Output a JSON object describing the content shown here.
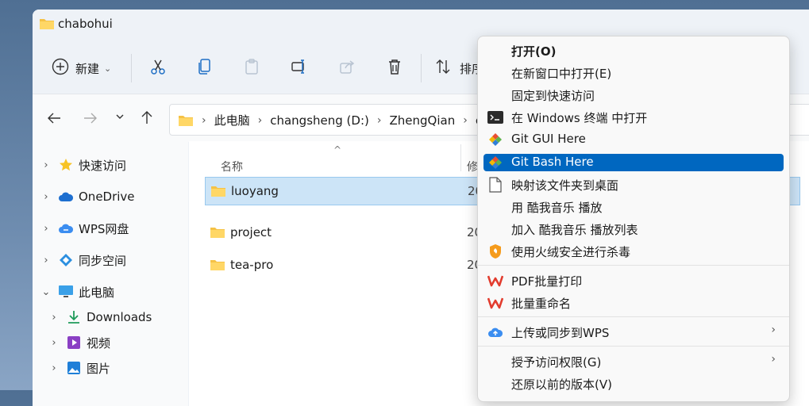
{
  "window": {
    "title": "chabohui"
  },
  "toolbar": {
    "new_label": "新建",
    "sort_label": "排序"
  },
  "breadcrumb": [
    "此电脑",
    "changsheng (D:)",
    "ZhengQian",
    "c"
  ],
  "sidebar": {
    "items": [
      {
        "label": "快速访问",
        "icon": "star-icon"
      },
      {
        "label": "OneDrive",
        "icon": "cloud-icon"
      },
      {
        "label": "WPS网盘",
        "icon": "wps-cloud-icon"
      },
      {
        "label": "同步空间",
        "icon": "sync-icon"
      },
      {
        "label": "此电脑",
        "icon": "computer-icon"
      },
      {
        "label": "Downloads",
        "icon": "download-icon"
      },
      {
        "label": "视频",
        "icon": "video-icon"
      },
      {
        "label": "图片",
        "icon": "picture-icon"
      }
    ]
  },
  "content": {
    "col_name": "名称",
    "col_modified": "修",
    "rows": [
      {
        "name": "luoyang",
        "date": "20"
      },
      {
        "name": "project",
        "date": "20"
      },
      {
        "name": "tea-pro",
        "date": "20"
      }
    ]
  },
  "menu": {
    "items": [
      {
        "label": "打开(O)"
      },
      {
        "label": "在新窗口中打开(E)"
      },
      {
        "label": "固定到快速访问"
      },
      {
        "label": "在 Windows 终端 中打开"
      },
      {
        "label": "Git GUI Here"
      },
      {
        "label": "Git Bash Here"
      },
      {
        "label": "映射该文件夹到桌面"
      },
      {
        "label": "用 酷我音乐 播放"
      },
      {
        "label": "加入 酷我音乐 播放列表"
      },
      {
        "label": "使用火绒安全进行杀毒"
      },
      {
        "label": "PDF批量打印"
      },
      {
        "label": "批量重命名"
      },
      {
        "label": "上传或同步到WPS"
      },
      {
        "label": "授予访问权限(G)"
      },
      {
        "label": "还原以前的版本(V)"
      }
    ]
  },
  "colors": {
    "accent": "#0067c0",
    "selection": "#cce4f7",
    "folder": "#f5c246"
  }
}
